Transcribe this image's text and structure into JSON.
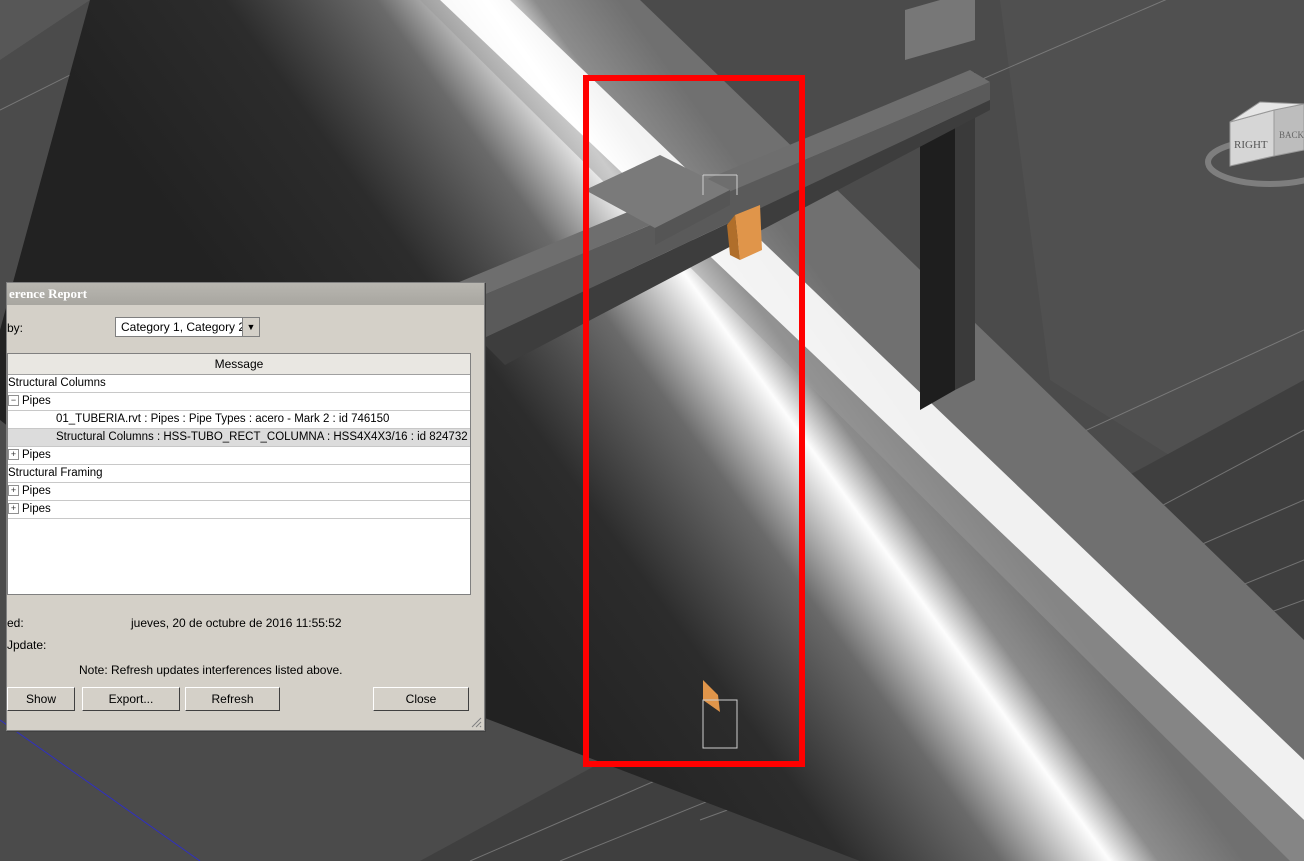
{
  "dialog": {
    "title": "erence Report",
    "group_by_label": "by:",
    "group_by_value": "Category 1, Category 2",
    "column_header": "Message",
    "rows": [
      {
        "level": 0,
        "text": "Structural Columns"
      },
      {
        "level": 1,
        "expander": "−",
        "text": "Pipes"
      },
      {
        "level": 2,
        "text": "01_TUBERIA.rvt : Pipes : Pipe Types : acero - Mark 2 : id 746150"
      },
      {
        "level": 2,
        "text": "Structural Columns : HSS-TUBO_RECT_COLUMNA : HSS4X4X3/16 : id 824732",
        "selected": true
      },
      {
        "level": 1,
        "expander": "+",
        "text": "Pipes"
      },
      {
        "level": 0,
        "text": "Structural Framing"
      },
      {
        "level": 1,
        "expander": "+",
        "text": "Pipes"
      },
      {
        "level": 1,
        "expander": "+",
        "text": "Pipes"
      }
    ],
    "created_label": "ed:",
    "created_value": "jueves, 20 de octubre de 2016 11:55:52",
    "update_label": "Jpdate:",
    "note": "Note: Refresh updates interferences listed above.",
    "buttons": {
      "show": "Show",
      "export": "Export...",
      "refresh": "Refresh",
      "close": "Close"
    }
  },
  "viewcube": {
    "face_right": "RIGHT",
    "face_back": "BACK"
  },
  "colors": {
    "highlight": "#ff0000",
    "element_orange": "#e0954a"
  }
}
